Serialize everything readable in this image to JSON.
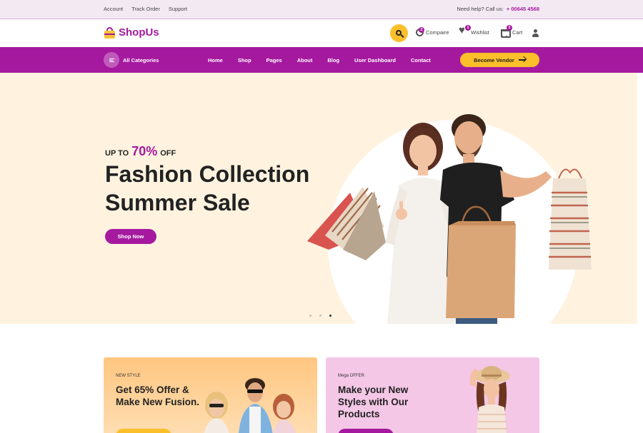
{
  "topbar": {
    "links": [
      "Account",
      "Track Order",
      "Support"
    ],
    "help_label": "Need help? Call us:",
    "phone": "+ 00645 4568"
  },
  "header": {
    "brand": "ShopUs",
    "compare": {
      "label": "Compaire",
      "count": "2"
    },
    "wishlist": {
      "label": "Wishlist",
      "count": "1"
    },
    "cart": {
      "label": "Cart",
      "count": "2"
    }
  },
  "nav": {
    "categories_label": "All Categories",
    "items": [
      "Home",
      "Shop",
      "Pages",
      "About",
      "Blog",
      "User Dashboard",
      "Contact"
    ],
    "vendor_button": "Become Vendor"
  },
  "hero": {
    "up_to": "UP TO",
    "percent": "70%",
    "off": "OFF",
    "title": "Fashion Collection Summer Sale",
    "button": "Shop Now",
    "slides_total": 3,
    "active_slide": 3
  },
  "promos": [
    {
      "tag": "NEW STYLE",
      "title": "Get 65% Offer & Make New Fusion."
    },
    {
      "tag": "Mega OFFER",
      "title": "Make your New Styles with Our Products"
    }
  ],
  "colors": {
    "brand": "#a5199f",
    "accent": "#fbbf2a",
    "hero_bg": "#fff3e0"
  }
}
